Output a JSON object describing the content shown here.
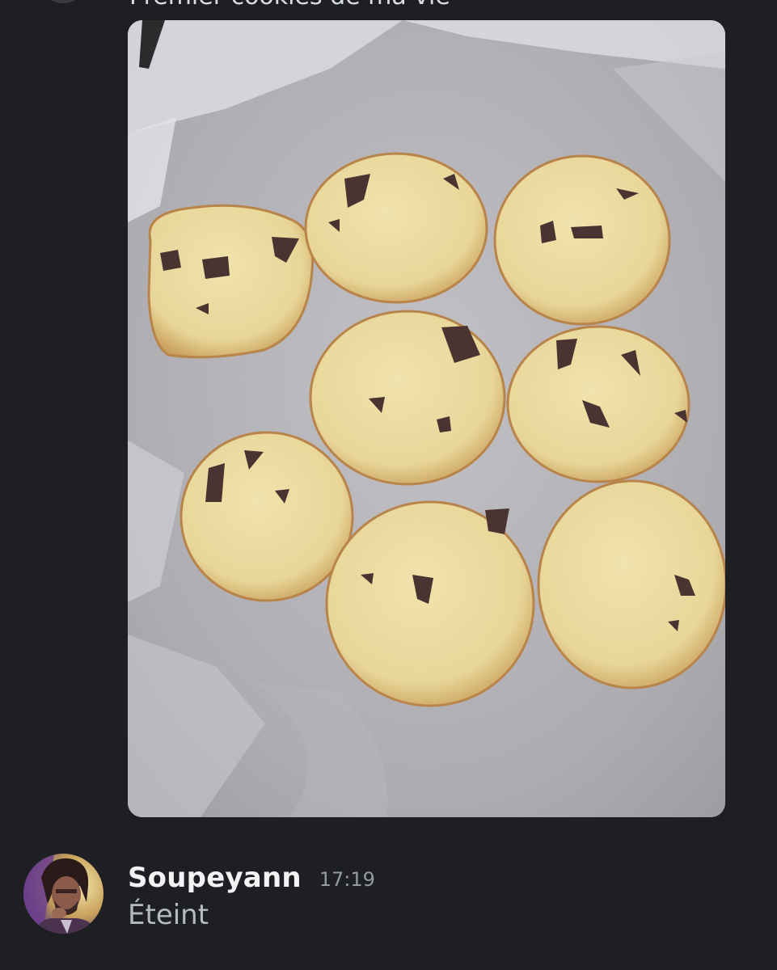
{
  "previous_message": {
    "text": "Premier cookies de ma vie",
    "image": {
      "alt": "photo-of-baked-chocolate-chip-cookies",
      "subject": "chocolate chip cookies on parchment paper",
      "cookie_count": 8
    }
  },
  "message": {
    "author": "Soupeyann",
    "timestamp": "17:19",
    "content": "Éteint",
    "avatar_icon": "user-avatar-portrait"
  },
  "colors": {
    "background": "#1e1f22",
    "username": "#f2f3f5",
    "timestamp": "#949ba4",
    "message_text": "#b5bac1"
  }
}
